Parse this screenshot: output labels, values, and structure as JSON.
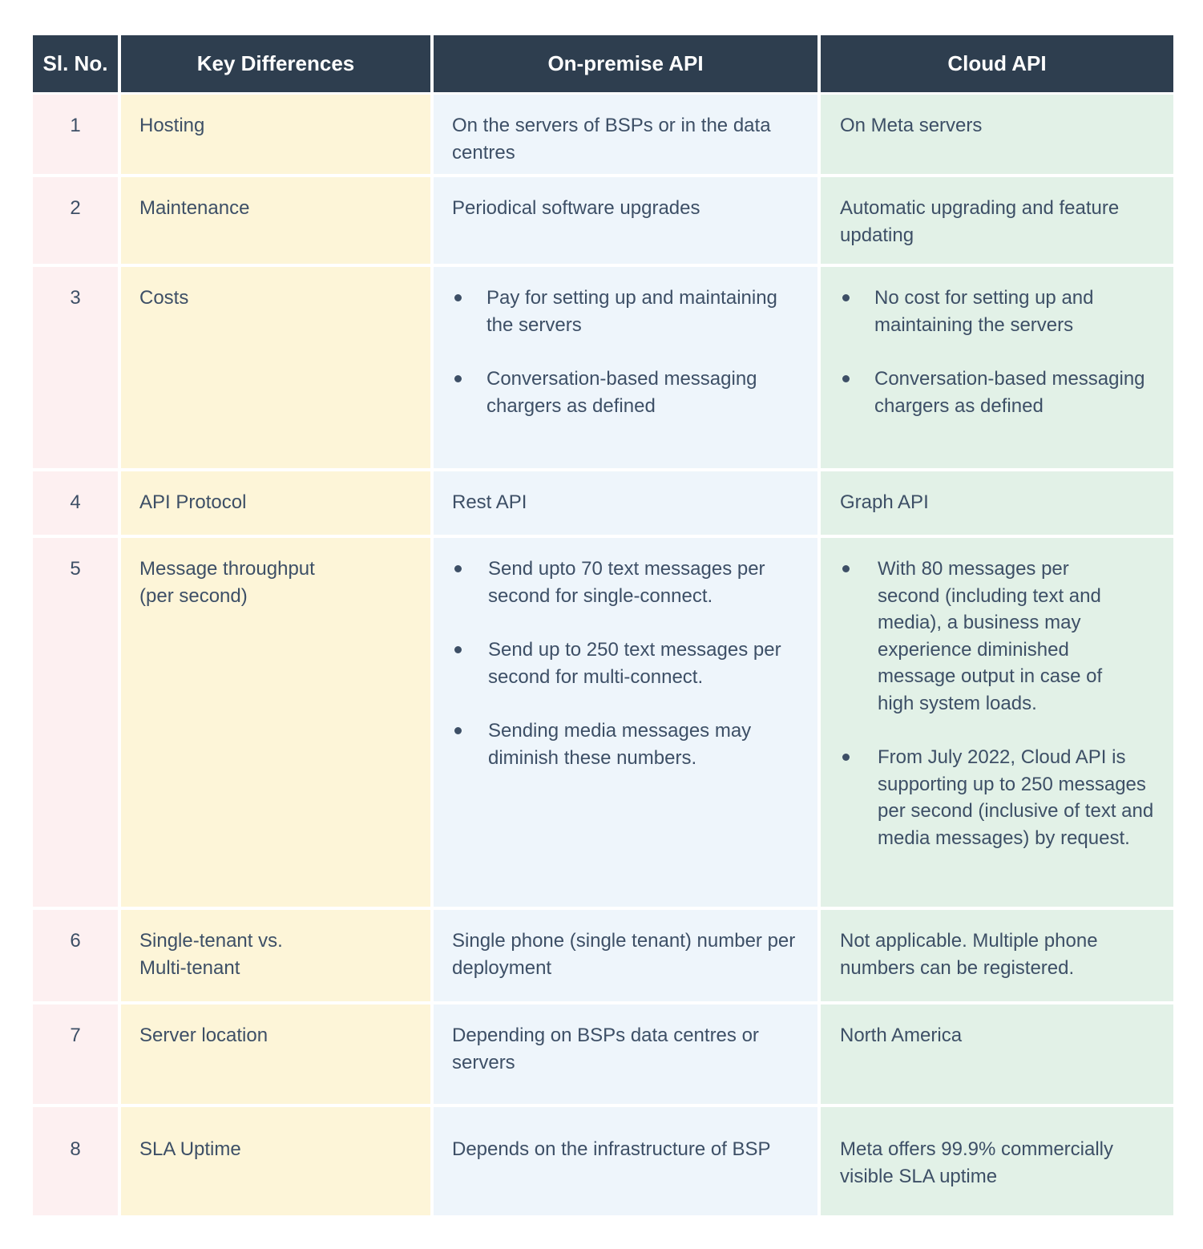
{
  "table": {
    "headers": [
      "Sl. No.",
      "Key Differences",
      "On-premise API",
      "Cloud API"
    ],
    "rows": [
      {
        "no": "1",
        "key": "Hosting",
        "onprem": "On the servers of BSPs or in the data centres",
        "cloud": "On Meta servers"
      },
      {
        "no": "2",
        "key": "Maintenance",
        "onprem": "Periodical software upgrades",
        "cloud": "Automatic upgrading and feature updating"
      },
      {
        "no": "3",
        "key": "Costs",
        "onprem_bullets": [
          "Pay for setting up and maintaining the servers",
          "Conversation-based messaging chargers as defined"
        ],
        "cloud_bullets": [
          "No cost for setting up and maintaining the servers",
          "Conversation-based messaging chargers as defined"
        ]
      },
      {
        "no": "4",
        "key": "API Protocol",
        "onprem": "Rest API",
        "cloud": "Graph API"
      },
      {
        "no": "5",
        "key": "Message throughput (per second)",
        "onprem_bullets": [
          "Send upto 70 text messages per second for single-connect.",
          "Send up to 250 text messages per second for multi-connect.",
          "Sending media messages may diminish these numbers."
        ],
        "cloud_bullets": [
          "With 80 messages per second (including text and media), a business may experience diminished message output in case of high system loads.",
          "From July 2022, Cloud API is supporting up to 250 messages per second (inclusive of text and media messages) by request."
        ]
      },
      {
        "no": "6",
        "key": "Single-tenant vs. Multi-tenant",
        "onprem": "Single phone (single tenant) number per deployment",
        "cloud": "Not applicable. Multiple phone numbers can be registered."
      },
      {
        "no": "7",
        "key": "Server location",
        "onprem": "Depending on BSPs data centres or servers",
        "cloud": "North America"
      },
      {
        "no": "8",
        "key": "SLA Uptime",
        "onprem": "Depends on the infrastructure of BSP",
        "cloud": "Meta offers 99.9% commercially visible SLA uptime"
      }
    ]
  },
  "colors": {
    "header_bg": "#2e3e4f",
    "col_no_bg": "#fdf0f1",
    "col_key_bg": "#fdf5d8",
    "col_onprem_bg": "#eef5fb",
    "col_cloud_bg": "#e2f1e7",
    "text": "#3d4f66"
  }
}
